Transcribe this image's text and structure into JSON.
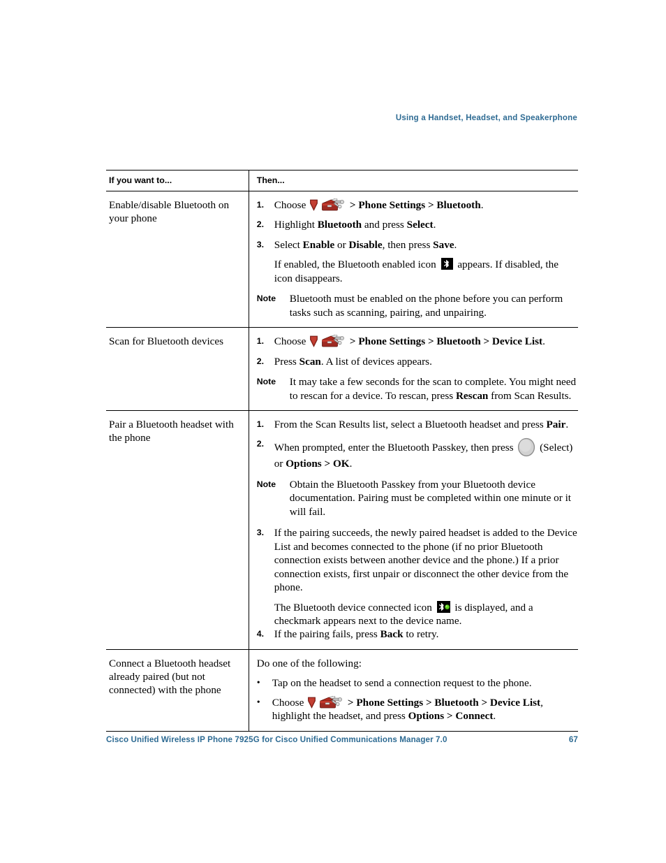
{
  "running_head": "Using a Handset, Headset, and Speakerphone",
  "colors": {
    "accent_blue": "#2e6b93",
    "toolbox_red": "#9e2a22",
    "status_green": "#5fd020",
    "rule_black": "#000000"
  },
  "table": {
    "headers": {
      "left": "If you want to...",
      "right": "Then..."
    },
    "rows": [
      {
        "task": "Enable/disable Bluetooth on your phone",
        "steps": [
          {
            "num": "1.",
            "parts": [
              {
                "type": "text",
                "text": "Choose "
              },
              {
                "type": "icon",
                "icon": "nav-arrow-icon"
              },
              {
                "type": "icon",
                "icon": "settings-toolbox-icon"
              },
              {
                "type": "bold",
                "text": " > Phone Settings > Bluetooth"
              },
              {
                "type": "text",
                "text": "."
              }
            ]
          },
          {
            "num": "2.",
            "parts": [
              {
                "type": "text",
                "text": "Highlight "
              },
              {
                "type": "bold",
                "text": "Bluetooth"
              },
              {
                "type": "text",
                "text": " and press "
              },
              {
                "type": "bold",
                "text": "Select"
              },
              {
                "type": "text",
                "text": "."
              }
            ]
          },
          {
            "num": "3.",
            "parts": [
              {
                "type": "text",
                "text": "Select "
              },
              {
                "type": "bold",
                "text": "Enable"
              },
              {
                "type": "text",
                "text": " or "
              },
              {
                "type": "bold",
                "text": "Disable"
              },
              {
                "type": "text",
                "text": ", then press "
              },
              {
                "type": "bold",
                "text": "Save"
              },
              {
                "type": "text",
                "text": "."
              }
            ]
          }
        ],
        "continuation": [
          {
            "type": "text",
            "text": "If enabled, the Bluetooth enabled icon "
          },
          {
            "type": "icon",
            "icon": "bluetooth-enabled-icon"
          },
          {
            "type": "text",
            "text": " appears. If disabled, the icon disappears."
          }
        ],
        "note": {
          "label": "Note",
          "text": "Bluetooth must be enabled on the phone before you can perform tasks such as scanning, pairing, and unpairing."
        }
      },
      {
        "task": "Scan for Bluetooth devices",
        "steps": [
          {
            "num": "1.",
            "parts": [
              {
                "type": "text",
                "text": "Choose "
              },
              {
                "type": "icon",
                "icon": "nav-arrow-icon"
              },
              {
                "type": "icon",
                "icon": "settings-toolbox-icon"
              },
              {
                "type": "bold",
                "text": " > Phone Settings > Bluetooth > Device List"
              },
              {
                "type": "text",
                "text": "."
              }
            ]
          },
          {
            "num": "2.",
            "parts": [
              {
                "type": "text",
                "text": "Press "
              },
              {
                "type": "bold",
                "text": "Scan"
              },
              {
                "type": "text",
                "text": ". A list of devices appears."
              }
            ]
          }
        ],
        "note": {
          "label": "Note",
          "parts": [
            {
              "type": "text",
              "text": "It may take a few seconds for the scan to complete. You might need to rescan for a device. To rescan, press "
            },
            {
              "type": "bold",
              "text": "Rescan"
            },
            {
              "type": "text",
              "text": " from Scan Results."
            }
          ]
        }
      },
      {
        "task": "Pair a Bluetooth headset with the phone",
        "steps": [
          {
            "num": "1.",
            "parts": [
              {
                "type": "text",
                "text": "From the Scan Results list, select a Bluetooth headset and press "
              },
              {
                "type": "bold",
                "text": "Pair"
              },
              {
                "type": "text",
                "text": "."
              }
            ]
          },
          {
            "num": "2.",
            "parts": [
              {
                "type": "text",
                "text": "When prompted, enter the Bluetooth Passkey, then press "
              },
              {
                "type": "icon",
                "icon": "select-key-icon"
              },
              {
                "type": "text",
                "text": " (Select) or "
              },
              {
                "type": "bold",
                "text": "Options > OK"
              },
              {
                "type": "text",
                "text": "."
              }
            ]
          }
        ],
        "note": {
          "label": "Note",
          "text": "Obtain the Bluetooth Passkey from your Bluetooth device documentation. Pairing must be completed within one minute or it will fail."
        },
        "steps_after_note": [
          {
            "num": "3.",
            "parts": [
              {
                "type": "text",
                "text": "If the pairing succeeds, the newly paired headset is added to the Device List and becomes connected to the phone (if no prior Bluetooth connection exists between another device and the phone.) If a prior connection exists, first unpair or disconnect the other device from the phone."
              }
            ],
            "sub_paragraph": [
              {
                "type": "text",
                "text": "The Bluetooth device connected icon "
              },
              {
                "type": "icon",
                "icon": "bluetooth-connected-icon"
              },
              {
                "type": "text",
                "text": " is displayed, and a checkmark appears next to the device name."
              }
            ]
          },
          {
            "num": "4.",
            "parts": [
              {
                "type": "text",
                "text": "If the pairing fails, press "
              },
              {
                "type": "bold",
                "text": "Back"
              },
              {
                "type": "text",
                "text": " to retry."
              }
            ]
          }
        ]
      },
      {
        "task": "Connect a Bluetooth headset already paired (but not connected) with the phone",
        "lead": "Do one of the following:",
        "bullets": [
          {
            "parts": [
              {
                "type": "text",
                "text": "Tap on the headset to send a connection request to the phone."
              }
            ]
          },
          {
            "parts": [
              {
                "type": "text",
                "text": "Choose "
              },
              {
                "type": "icon",
                "icon": "nav-arrow-icon"
              },
              {
                "type": "icon",
                "icon": "settings-toolbox-icon"
              },
              {
                "type": "bold",
                "text": " > Phone Settings > Bluetooth > Device List"
              },
              {
                "type": "text",
                "text": ", highlight the headset, and press "
              },
              {
                "type": "bold",
                "text": "Options > Connect"
              },
              {
                "type": "text",
                "text": "."
              }
            ]
          }
        ]
      }
    ]
  },
  "footer": {
    "title": "Cisco Unified Wireless IP Phone 7925G for Cisco Unified Communications Manager 7.0",
    "page_number": "67"
  }
}
